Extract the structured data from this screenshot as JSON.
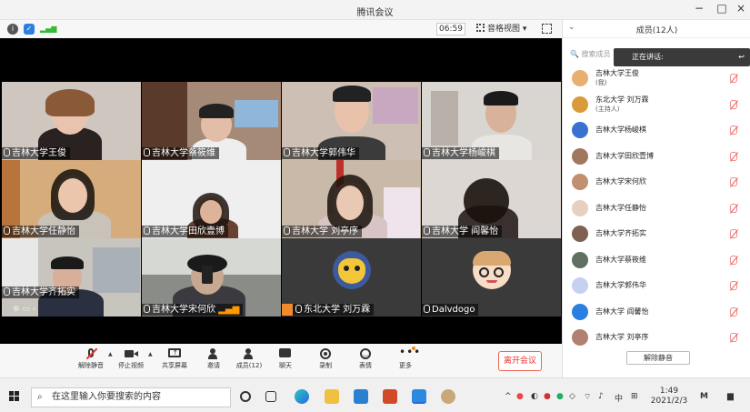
{
  "window": {
    "title": "腾讯会议"
  },
  "top_toolbar": {
    "timer": "06:59",
    "view_label": "音格视图"
  },
  "participants_tiles": [
    {
      "name": "吉林大学王俊"
    },
    {
      "name": "吉林大学蔡筱维"
    },
    {
      "name": "吉林大学郭伟华"
    },
    {
      "name": "吉林大学杨峻棋"
    },
    {
      "name": "吉林大学任静怡"
    },
    {
      "name": "吉林大学田欣壹博"
    },
    {
      "name": "吉林大学 刘亭序"
    },
    {
      "name": "吉林大学 阎馨怡"
    },
    {
      "name": "吉林大学齐拓实"
    },
    {
      "name": "吉林大学宋何欣"
    },
    {
      "name": "东北大学 刘万霖"
    },
    {
      "name": "Dalvdogo"
    }
  ],
  "bottom_toolbar": {
    "unmute": "解除静音",
    "start_video": "停止视频",
    "share": "共享屏幕",
    "invite": "邀请",
    "members": "成员(12)",
    "chat": "聊天",
    "record": "录制",
    "reactions": "表情",
    "more": "更多",
    "leave": "离开会议"
  },
  "members_panel": {
    "title": "成员(12人)",
    "search_placeholder": "搜索成员",
    "speaking_label": "正在讲话:",
    "mute_all": "解除静音",
    "members": [
      {
        "name": "吉林大学王俊",
        "sub": "(我)",
        "color": "#e8b070"
      },
      {
        "name": "东北大学 刘万霖",
        "sub": "(主持人)",
        "color": "#d89a3a"
      },
      {
        "name": "吉林大学杨峻棋",
        "sub": "",
        "color": "#3a70d0"
      },
      {
        "name": "吉林大学田欣壹博",
        "sub": "",
        "color": "#a07860"
      },
      {
        "name": "吉林大学宋何欣",
        "sub": "",
        "color": "#c09070"
      },
      {
        "name": "吉林大学任静怡",
        "sub": "",
        "color": "#e8d0c0"
      },
      {
        "name": "吉林大学齐拓实",
        "sub": "",
        "color": "#806050"
      },
      {
        "name": "吉林大学蔡筱维",
        "sub": "",
        "color": "#607060"
      },
      {
        "name": "吉林大学郭伟华",
        "sub": "",
        "color": "#c8d0f0"
      },
      {
        "name": "吉林大学 阎馨怡",
        "sub": "",
        "color": "#2a80e0"
      },
      {
        "name": "吉林大学 刘亭序",
        "sub": "",
        "color": "#b08070"
      }
    ]
  },
  "taskbar": {
    "search_placeholder": "在这里输入你要搜索的内容",
    "ime": "中",
    "time": "1:49",
    "date": "2021/2/3"
  }
}
